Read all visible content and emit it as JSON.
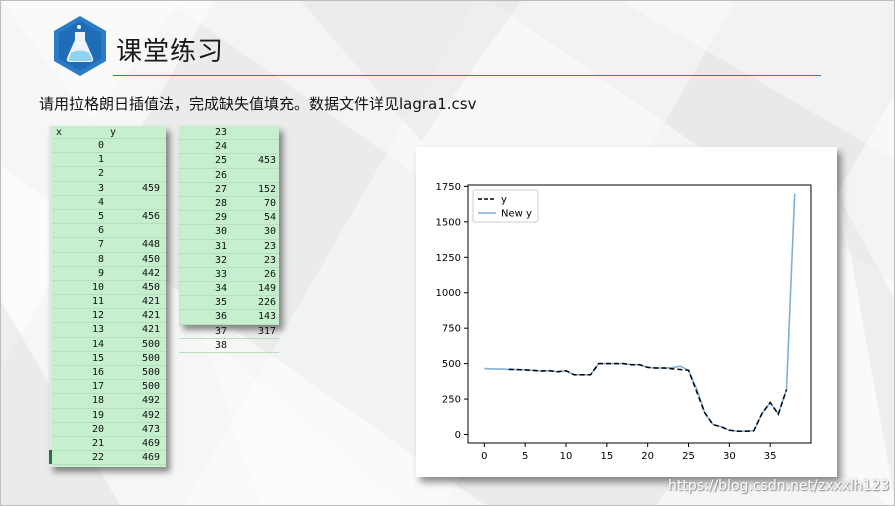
{
  "slide": {
    "title": "课堂练习",
    "instruction": "请用拉格朗日插值法，完成缺失值填充。数据文件详见lagra1.csv",
    "watermark": "https://blog.csdn.net/zxxxlh123",
    "colors": {
      "accent": "#2f78c4",
      "logo": "#2a7cc7",
      "sheet_fill": "#c6efce"
    }
  },
  "spreadsheet": {
    "header": {
      "x": "x",
      "y": "y"
    },
    "left_rows": [
      {
        "x": "0",
        "y": ""
      },
      {
        "x": "1",
        "y": ""
      },
      {
        "x": "2",
        "y": ""
      },
      {
        "x": "3",
        "y": "459"
      },
      {
        "x": "4",
        "y": ""
      },
      {
        "x": "5",
        "y": "456"
      },
      {
        "x": "6",
        "y": ""
      },
      {
        "x": "7",
        "y": "448"
      },
      {
        "x": "8",
        "y": "450"
      },
      {
        "x": "9",
        "y": "442"
      },
      {
        "x": "10",
        "y": "450"
      },
      {
        "x": "11",
        "y": "421"
      },
      {
        "x": "12",
        "y": "421"
      },
      {
        "x": "13",
        "y": "421"
      },
      {
        "x": "14",
        "y": "500"
      },
      {
        "x": "15",
        "y": "500"
      },
      {
        "x": "16",
        "y": "500"
      },
      {
        "x": "17",
        "y": "500"
      },
      {
        "x": "18",
        "y": "492"
      },
      {
        "x": "19",
        "y": "492"
      },
      {
        "x": "20",
        "y": "473"
      },
      {
        "x": "21",
        "y": "469"
      },
      {
        "x": "22",
        "y": "469"
      }
    ],
    "right_rows": [
      {
        "x": "23",
        "y": ""
      },
      {
        "x": "24",
        "y": ""
      },
      {
        "x": "25",
        "y": "453"
      },
      {
        "x": "26",
        "y": ""
      },
      {
        "x": "27",
        "y": "152"
      },
      {
        "x": "28",
        "y": "70"
      },
      {
        "x": "29",
        "y": "54"
      },
      {
        "x": "30",
        "y": "30"
      },
      {
        "x": "31",
        "y": "23"
      },
      {
        "x": "32",
        "y": "23"
      },
      {
        "x": "33",
        "y": "26"
      },
      {
        "x": "34",
        "y": "149"
      },
      {
        "x": "35",
        "y": "226"
      },
      {
        "x": "36",
        "y": "143"
      },
      {
        "x": "37",
        "y": "317"
      },
      {
        "x": "38",
        "y": ""
      }
    ]
  },
  "chart_data": {
    "type": "line",
    "xlim": [
      -2,
      40
    ],
    "ylim": [
      -60,
      1760
    ],
    "xticks": [
      0,
      5,
      10,
      15,
      20,
      25,
      30,
      35
    ],
    "yticks": [
      0,
      250,
      500,
      750,
      1000,
      1250,
      1500,
      1750
    ],
    "legend_position": "top-left",
    "grid": false,
    "series": [
      {
        "name": "y",
        "style": "dashed",
        "color": "#000000",
        "x": [
          3,
          5,
          7,
          8,
          9,
          10,
          11,
          12,
          13,
          14,
          15,
          16,
          17,
          18,
          19,
          20,
          21,
          22,
          25,
          27,
          28,
          29,
          30,
          31,
          32,
          33,
          34,
          35,
          36,
          37
        ],
        "y": [
          459,
          456,
          448,
          450,
          442,
          450,
          421,
          421,
          421,
          500,
          500,
          500,
          500,
          492,
          492,
          473,
          469,
          469,
          453,
          152,
          70,
          54,
          30,
          23,
          23,
          26,
          149,
          226,
          143,
          317
        ]
      },
      {
        "name": "New y",
        "style": "solid",
        "color": "#7fb0d8",
        "x": [
          0,
          1,
          2,
          3,
          4,
          5,
          6,
          7,
          8,
          9,
          10,
          11,
          12,
          13,
          14,
          15,
          16,
          17,
          18,
          19,
          20,
          21,
          22,
          23,
          24,
          25,
          26,
          27,
          28,
          29,
          30,
          31,
          32,
          33,
          34,
          35,
          36,
          37,
          38
        ],
        "y": [
          465,
          463,
          461,
          459,
          458,
          456,
          452,
          448,
          450,
          442,
          450,
          421,
          421,
          421,
          500,
          500,
          500,
          500,
          492,
          492,
          473,
          469,
          469,
          471,
          482,
          453,
          320,
          152,
          70,
          54,
          30,
          23,
          23,
          26,
          149,
          226,
          143,
          317,
          1700
        ]
      }
    ]
  }
}
